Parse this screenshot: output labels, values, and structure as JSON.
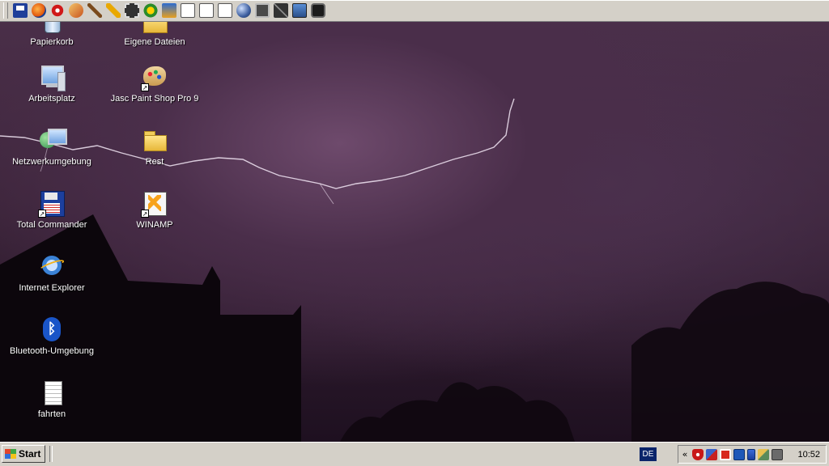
{
  "toolbar": {
    "icons": [
      "save-icon",
      "firefox-icon",
      "star-burst-icon",
      "paint-shop-icon",
      "brush-icon",
      "feather-icon",
      "film-icon",
      "media-player-icon",
      "user-icon",
      "document-icon",
      "document-icon",
      "document-icon",
      "globe-icon",
      "padlock-icon",
      "tools-icon",
      "camera-icon",
      "photo-camera-icon"
    ]
  },
  "desktop": {
    "icons": [
      {
        "label": "Papierkorb",
        "icon": "recycle-bin-icon"
      },
      {
        "label": "Eigene Dateien",
        "icon": "my-documents-folder-icon"
      },
      {
        "label": "Arbeitsplatz",
        "icon": "my-computer-icon"
      },
      {
        "label": "Jasc Paint Shop Pro 9",
        "icon": "paint-palette-icon"
      },
      {
        "label": "Netzwerkumgebung",
        "icon": "network-places-icon"
      },
      {
        "label": "Rest",
        "icon": "folder-icon"
      },
      {
        "label": "Total Commander",
        "icon": "floppy-disk-icon"
      },
      {
        "label": "WINAMP",
        "icon": "winamp-icon"
      },
      {
        "label": "Internet Explorer",
        "icon": "internet-explorer-icon"
      },
      {
        "label": "Bluetooth-Umgebung",
        "icon": "bluetooth-icon"
      },
      {
        "label": "fahrten",
        "icon": "text-document-icon"
      }
    ]
  },
  "taskbar": {
    "start_label": "Start",
    "language": "DE",
    "tray_chevron": "«",
    "clock": "10:52",
    "tray_icons": [
      "shield-icon",
      "network-icon",
      "antivirus-icon",
      "monitor-icon",
      "battery-icon",
      "connection-icon",
      "display-icon"
    ]
  },
  "colors": {
    "taskbar": "#d4d0c8",
    "sky": "#4a2f48",
    "lightning": "#f2e6f4",
    "language_bg": "#0a246a"
  }
}
